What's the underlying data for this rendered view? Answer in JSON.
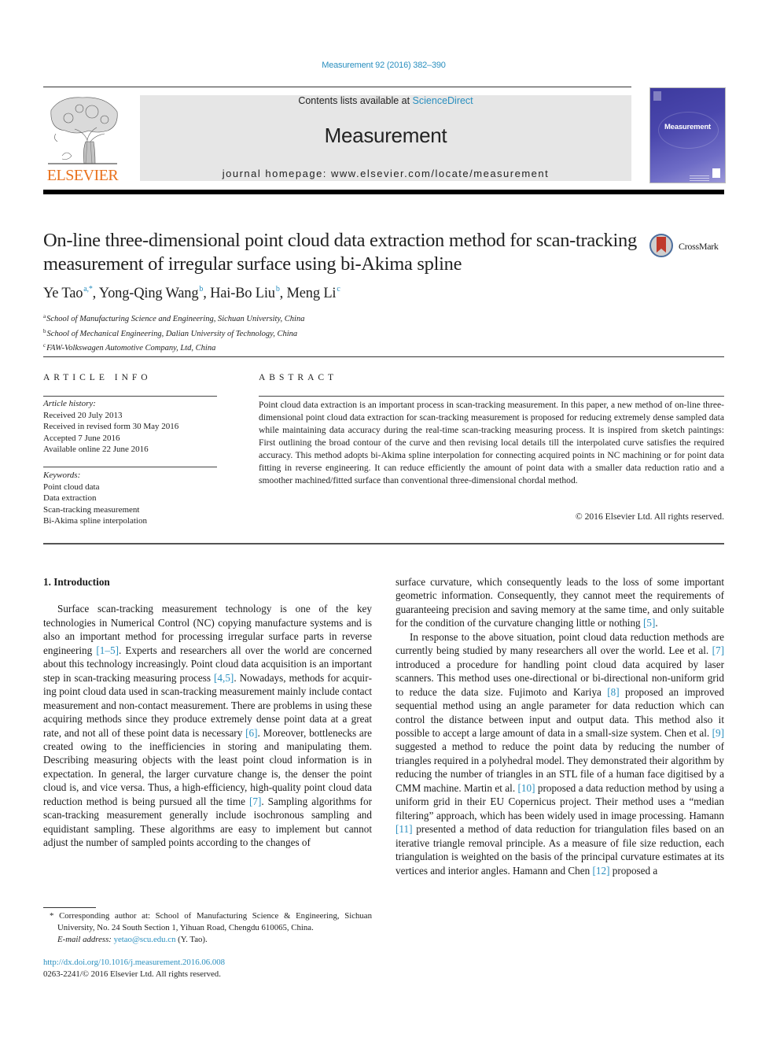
{
  "header": {
    "journal_ref": "Measurement 92 (2016) 382–390",
    "contents_prefix": "Contents lists available at ",
    "contents_link": "ScienceDirect",
    "journal_title": "Measurement",
    "homepage": "journal homepage: www.elsevier.com/locate/measurement",
    "publisher": "ELSEVIER",
    "cover_title": "Measurement",
    "accent_color": "#2a8fbf",
    "publisher_color": "#e9711c"
  },
  "article": {
    "title": "On-line three-dimensional point cloud data extraction method for scan-tracking measurement of irregular surface using bi-Akima spline",
    "crossmark_label": "CrossMark",
    "authors": [
      {
        "name": "Ye Tao",
        "sup": "a,*"
      },
      {
        "name": "Yong-Qing Wang",
        "sup": "b"
      },
      {
        "name": "Hai-Bo Liu",
        "sup": "b"
      },
      {
        "name": "Meng Li",
        "sup": "c"
      }
    ],
    "affiliations": [
      {
        "key": "a",
        "text": "School of Manufacturing Science and Engineering, Sichuan University, China"
      },
      {
        "key": "b",
        "text": "School of Mechanical Engineering, Dalian University of Technology, China"
      },
      {
        "key": "c",
        "text": "FAW-Volkswagen Automotive Company, Ltd, China"
      }
    ]
  },
  "article_info": {
    "heading": "ARTICLE INFO",
    "history_label": "Article history:",
    "history": [
      "Received 20 July 2013",
      "Received in revised form 30 May 2016",
      "Accepted 7 June 2016",
      "Available online 22 June 2016"
    ],
    "keywords_label": "Keywords:",
    "keywords": [
      "Point cloud data",
      "Data extraction",
      "Scan-tracking measurement",
      "Bi-Akima spline interpolation"
    ]
  },
  "abstract": {
    "heading": "ABSTRACT",
    "text": "Point cloud data extraction is an important process in scan-tracking measurement. In this paper, a new method of on-line three-dimensional point cloud data extraction for scan-tracking measurement is pro­posed for reducing extremely dense sampled data while maintaining data accuracy during the real-time scan-tracking measuring process. It is inspired from sketch paintings: First outlining the broad contour of the curve and then revising local details till the interpolated curve satisfies the required accuracy. This method adopts bi-Akima spline interpolation for connecting acquired points in NC machining or for point data fitting in reverse engineering. It can reduce efficiently the amount of point data with a smaller data reduction ratio and a smoother machined/fitted surface than conventional three-dimensional chordal method.",
    "copyright": "© 2016 Elsevier Ltd. All rights reserved."
  },
  "body": {
    "section_heading": "1. Introduction",
    "left_paragraphs": [
      [
        {
          "t": "Surface scan-tracking measurement technology is one of the key technologies in Numerical Control (NC) copying manufacture systems and is also an important method for processing irregular surface parts in reverse engineering "
        },
        {
          "ref": "[1–5]"
        },
        {
          "t": ". Experts and researchers all over the world are concerned about this technology increas­ingly. Point cloud data acquisition is an important step in scan-tracking measuring process "
        },
        {
          "ref": "[4,5]"
        },
        {
          "t": ". Nowadays, methods for acquir­ing point cloud data used in scan-tracking measurement mainly include contact measurement and non-contact measurement. There are problems in using these acquiring methods since they produce extremely dense point data at a great rate, and not all of these point data is necessary "
        },
        {
          "ref": "[6]"
        },
        {
          "t": ". Moreover, bottlenecks are created owing to the inefficiencies in storing and manipulating them. Describing measuring objects with the least point cloud informa­tion is in expectation. In general, the larger curvature change is, the denser the point cloud is, and vice versa. Thus, a high-efficiency, high-quality point cloud data reduction method is being pursued all the time "
        },
        {
          "ref": "[7]"
        },
        {
          "t": ". Sampling algorithms for scan-tracking measurement generally include isochronous sampling and equidis­tant sampling. These algorithms are easy to implement but cannot adjust the number of sampled points according to the changes of"
        }
      ]
    ],
    "right_paragraphs": [
      [
        {
          "t": "surface curvature, which consequently leads to the loss of some important geometric information. Consequently, they cannot meet the requirements of guaranteeing precision and saving memory at the same time, and only suitable for the condition of the curvature changing little or nothing "
        },
        {
          "ref": "[5]"
        },
        {
          "t": "."
        }
      ],
      [
        {
          "t": "In response to the above situation, point cloud data reduction methods are currently being studied by many researchers all over the world. Lee et al. "
        },
        {
          "ref": "[7]"
        },
        {
          "t": " introduced a procedure for handling point cloud data acquired by laser scanners. This method uses one-directional or bi-directional non-uniform grid to reduce the data size. Fujimoto and Kariya "
        },
        {
          "ref": "[8]"
        },
        {
          "t": " proposed an improved sequential method using an angle parameter for data reduction which can control the distance between input and output data. This method also it possible to accept a large amount of data in a small-size sys­tem. Chen et al. "
        },
        {
          "ref": "[9]"
        },
        {
          "t": " suggested a method to reduce the point data by reducing the number of triangles required in a polyhedral model. They demonstrated their algorithm by reducing the number of tri­angles in an STL file of a human face digitised by a CMM machine. Martin et al. "
        },
        {
          "ref": "[10]"
        },
        {
          "t": " proposed a data reduction method by using a uni­form grid in their EU Copernicus project. Their method uses a “me­dian filtering” approach, which has been widely used in image processing. Hamann "
        },
        {
          "ref": "[11]"
        },
        {
          "t": " presented a method of data reduction for triangulation files based on an iterative triangle removal princi­ple. As a measure of file size reduction, each triangulation is weighted on the basis of the principal curvature estimates at its vertices and interior angles. Hamann and Chen "
        },
        {
          "ref": "[12]"
        },
        {
          "t": " proposed a"
        }
      ]
    ]
  },
  "footnote": {
    "corresponding": "* Corresponding author at: School of Manufacturing Science & Engineering, Sichuan University, No. 24 South Section 1, Yihuan Road, Chengdu 610065, China.",
    "email_label": "E-mail address: ",
    "email": "yetao@scu.edu.cn",
    "email_suffix": " (Y. Tao).",
    "doi": "http://dx.doi.org/10.1016/j.measurement.2016.06.008",
    "issn_line": "0263-2241/© 2016 Elsevier Ltd. All rights reserved."
  }
}
